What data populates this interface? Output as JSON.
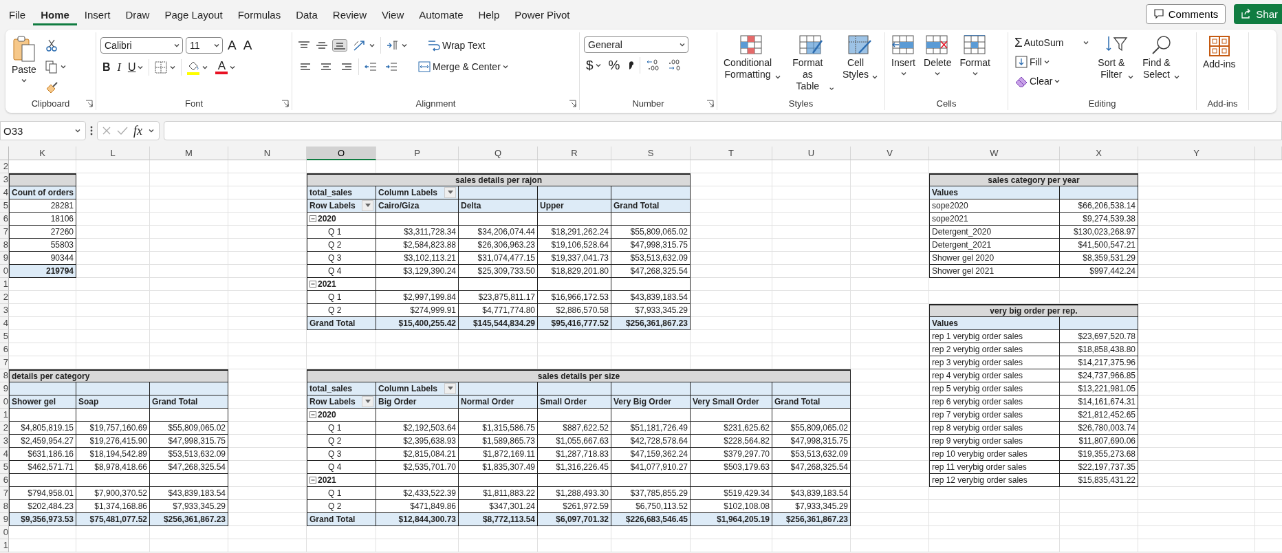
{
  "ribbon_tabs": [
    {
      "label": "File",
      "selected": false
    },
    {
      "label": "Home",
      "selected": true
    },
    {
      "label": "Insert",
      "selected": false
    },
    {
      "label": "Draw",
      "selected": false
    },
    {
      "label": "Page Layout",
      "selected": false
    },
    {
      "label": "Formulas",
      "selected": false
    },
    {
      "label": "Data",
      "selected": false
    },
    {
      "label": "Review",
      "selected": false
    },
    {
      "label": "View",
      "selected": false
    },
    {
      "label": "Automate",
      "selected": false
    },
    {
      "label": "Help",
      "selected": false
    },
    {
      "label": "Power Pivot",
      "selected": false
    }
  ],
  "header_buttons": {
    "comments": "Comments",
    "share": "Shar"
  },
  "ribbon_groups": [
    {
      "kind": "clipboard",
      "label": "Clipboard",
      "paste": "Paste"
    },
    {
      "kind": "font",
      "label": "Font",
      "font_name": "Calibri",
      "font_size": "11",
      "grow_font": "A",
      "shrink_font": "A",
      "bold": "B",
      "italic": "I",
      "underline": "U",
      "font_color": "A"
    },
    {
      "kind": "alignment",
      "label": "Alignment",
      "vertical_align": [
        {
          "selected": false
        },
        {
          "selected": false
        },
        {
          "selected": true
        }
      ],
      "wrap_text": "Wrap Text",
      "merge_center": "Merge & Center"
    },
    {
      "kind": "number",
      "label": "Number",
      "format": "General",
      "currency": "$",
      "percent": "%"
    },
    {
      "kind": "styles",
      "label": "Styles",
      "buttons": [
        {
          "lines": [
            "Conditional",
            "Formatting"
          ]
        },
        {
          "lines": [
            "Format as",
            "Table"
          ]
        },
        {
          "lines": [
            "Cell",
            "Styles"
          ]
        }
      ]
    },
    {
      "kind": "cells",
      "label": "Cells",
      "buttons": [
        "Insert",
        "Delete",
        "Format"
      ]
    },
    {
      "kind": "editing",
      "label": "Editing",
      "autosum_symbol": "Σ",
      "autosum": "AutoSum",
      "fill": "Fill",
      "clear": "Clear",
      "buttons": [
        {
          "lines": [
            "Sort &",
            "Filter"
          ]
        },
        {
          "lines": [
            "Find &",
            "Select"
          ]
        }
      ]
    },
    {
      "kind": "addins",
      "label": "Add-ins",
      "button": "Add-ins"
    }
  ],
  "formula_bar": {
    "name_box": "O33",
    "function_label": "fx"
  },
  "sheet": {
    "column_headers": [
      {
        "label": "K",
        "selected": false
      },
      {
        "label": "L",
        "selected": false
      },
      {
        "label": "M",
        "selected": false
      },
      {
        "label": "N",
        "selected": false
      },
      {
        "label": "O",
        "selected": true
      },
      {
        "label": "P",
        "selected": false
      },
      {
        "label": "Q",
        "selected": false
      },
      {
        "label": "R",
        "selected": false
      },
      {
        "label": "S",
        "selected": false
      },
      {
        "label": "T",
        "selected": false
      },
      {
        "label": "U",
        "selected": false
      },
      {
        "label": "V",
        "selected": false
      },
      {
        "label": "W",
        "selected": false
      },
      {
        "label": "X",
        "selected": false
      },
      {
        "label": "Y",
        "selected": false
      }
    ],
    "row_headers": [
      "2",
      "3",
      "4",
      "5",
      "6",
      "7",
      "8",
      "9",
      "0",
      "1",
      "2",
      "3",
      "4",
      "5",
      "6",
      "7",
      "8",
      "9",
      "0",
      "1",
      "2",
      "3",
      "4",
      "5",
      "6",
      "7",
      "8",
      "9",
      "0",
      "1"
    ]
  },
  "tables": [
    {
      "kind": "count",
      "header": "Count of orders",
      "values": [
        "28281",
        "18106",
        "27260",
        "55803",
        "90344"
      ],
      "total": "219794"
    },
    {
      "kind": "pivot",
      "title": "sales details per rajon",
      "value_field": "total_sales",
      "column_labels": "Column Labels",
      "row_labels": "Row Labels",
      "columns": [
        "Cairo/Giza",
        "Delta",
        "Upper",
        "Grand Total"
      ],
      "groups": [
        {
          "year": "2020",
          "expanded": true,
          "rows": [
            {
              "label": "Q 1",
              "values": [
                "$3,311,728.34",
                "$34,206,074.44",
                "$18,291,262.24",
                "$55,809,065.02"
              ]
            },
            {
              "label": "Q 2",
              "values": [
                "$2,584,823.88",
                "$26,306,963.23",
                "$19,106,528.64",
                "$47,998,315.75"
              ]
            },
            {
              "label": "Q 3",
              "values": [
                "$3,102,113.21",
                "$31,074,477.15",
                "$19,337,041.73",
                "$53,513,632.09"
              ]
            },
            {
              "label": "Q 4",
              "values": [
                "$3,129,390.24",
                "$25,309,733.50",
                "$18,829,201.80",
                "$47,268,325.54"
              ]
            }
          ]
        },
        {
          "year": "2021",
          "expanded": true,
          "rows": [
            {
              "label": "Q 1",
              "values": [
                "$2,997,199.84",
                "$23,875,811.17",
                "$16,966,172.53",
                "$43,839,183.54"
              ]
            },
            {
              "label": "Q 2",
              "values": [
                "$274,999.91",
                "$4,771,774.80",
                "$2,886,570.58",
                "$7,933,345.29"
              ]
            }
          ]
        }
      ],
      "grand_total": {
        "label": "Grand Total",
        "values": [
          "$15,400,255.42",
          "$145,544,834.29",
          "$95,416,777.52",
          "$256,361,867.23"
        ]
      }
    },
    {
      "kind": "values",
      "title": "sales category per year",
      "header": "Values",
      "rows": [
        {
          "label": "sope2020",
          "value": "$66,206,538.14"
        },
        {
          "label": "sope2021",
          "value": "$9,274,539.38"
        },
        {
          "label": "Detergent_2020",
          "value": "$130,023,268.97"
        },
        {
          "label": "Detergent_2021",
          "value": "$41,500,547.21"
        },
        {
          "label": "Shower gel 2020",
          "value": "$8,359,531.29"
        },
        {
          "label": "Shower gel 2021",
          "value": "$997,442.24"
        }
      ]
    },
    {
      "kind": "values",
      "title": "very big order per rep.",
      "header": "Values",
      "rows": [
        {
          "label": "rep 1 verybig order sales",
          "value": "$23,697,520.78"
        },
        {
          "label": "rep 2 verybig order sales",
          "value": "$18,858,438.80"
        },
        {
          "label": "rep 3 verybig order sales",
          "value": "$14,217,375.96"
        },
        {
          "label": "rep 4 verybig order sales",
          "value": "$24,737,966.85"
        },
        {
          "label": "rep 5 verybig order sales",
          "value": "$13,221,981.05"
        },
        {
          "label": "rep 6 verybig order sales",
          "value": "$14,161,674.31"
        },
        {
          "label": "rep 7 verybig order sales",
          "value": "$21,812,452.65"
        },
        {
          "label": "rep 8 verybig order sales",
          "value": "$26,780,003.74"
        },
        {
          "label": "rep 9 verybig order sales",
          "value": "$11,807,690.06"
        },
        {
          "label": "rep 10 verybig order sales",
          "value": "$19,355,273.68"
        },
        {
          "label": "rep 11 verybig order sales",
          "value": "$22,197,737.35"
        },
        {
          "label": "rep 12 verybig order sales",
          "value": "$15,835,431.22"
        }
      ]
    },
    {
      "kind": "category",
      "title": "details per category",
      "columns": [
        "Shower gel",
        "Soap",
        "Grand Total"
      ],
      "groups": [
        {
          "rows": [
            [
              "$4,805,819.15",
              "$19,757,160.69",
              "$55,809,065.02"
            ],
            [
              "$2,459,954.27",
              "$19,276,415.90",
              "$47,998,315.75"
            ],
            [
              "$631,186.16",
              "$18,194,542.89",
              "$53,513,632.09"
            ],
            [
              "$462,571.71",
              "$8,978,418.66",
              "$47,268,325.54"
            ]
          ]
        },
        {
          "rows": [
            [
              "$794,958.01",
              "$7,900,370.52",
              "$43,839,183.54"
            ],
            [
              "$202,484.23",
              "$1,374,168.86",
              "$7,933,345.29"
            ]
          ]
        }
      ],
      "totals": [
        "$9,356,973.53",
        "$75,481,077.52",
        "$256,361,867.23"
      ]
    },
    {
      "kind": "pivot",
      "title": "sales details per size",
      "value_field": "total_sales",
      "column_labels": "Column Labels",
      "row_labels": "Row Labels",
      "columns": [
        "Big Order",
        "Normal Order",
        "Small Order",
        "Very Big Order",
        "Very Small Order",
        "Grand Total"
      ],
      "groups": [
        {
          "year": "2020",
          "expanded": true,
          "rows": [
            {
              "label": "Q 1",
              "values": [
                "$2,192,503.64",
                "$1,315,586.75",
                "$887,622.52",
                "$51,181,726.49",
                "$231,625.62",
                "$55,809,065.02"
              ]
            },
            {
              "label": "Q 2",
              "values": [
                "$2,395,638.93",
                "$1,589,865.73",
                "$1,055,667.63",
                "$42,728,578.64",
                "$228,564.82",
                "$47,998,315.75"
              ]
            },
            {
              "label": "Q 3",
              "values": [
                "$2,815,084.21",
                "$1,872,169.11",
                "$1,287,718.83",
                "$47,159,362.24",
                "$379,297.70",
                "$53,513,632.09"
              ]
            },
            {
              "label": "Q 4",
              "values": [
                "$2,535,701.70",
                "$1,835,307.49",
                "$1,316,226.45",
                "$41,077,910.27",
                "$503,179.63",
                "$47,268,325.54"
              ]
            }
          ]
        },
        {
          "year": "2021",
          "expanded": true,
          "rows": [
            {
              "label": "Q 1",
              "values": [
                "$2,433,522.39",
                "$1,811,883.22",
                "$1,288,493.30",
                "$37,785,855.29",
                "$519,429.34",
                "$43,839,183.54"
              ]
            },
            {
              "label": "Q 2",
              "values": [
                "$471,849.86",
                "$347,301.24",
                "$261,972.59",
                "$6,750,113.52",
                "$102,108.08",
                "$7,933,345.29"
              ]
            }
          ]
        }
      ],
      "grand_total": {
        "label": "Grand Total",
        "values": [
          "$12,844,300.73",
          "$8,772,113.54",
          "$6,097,701.32",
          "$226,683,546.45",
          "$1,964,205.19",
          "$256,361,867.23"
        ]
      }
    }
  ]
}
